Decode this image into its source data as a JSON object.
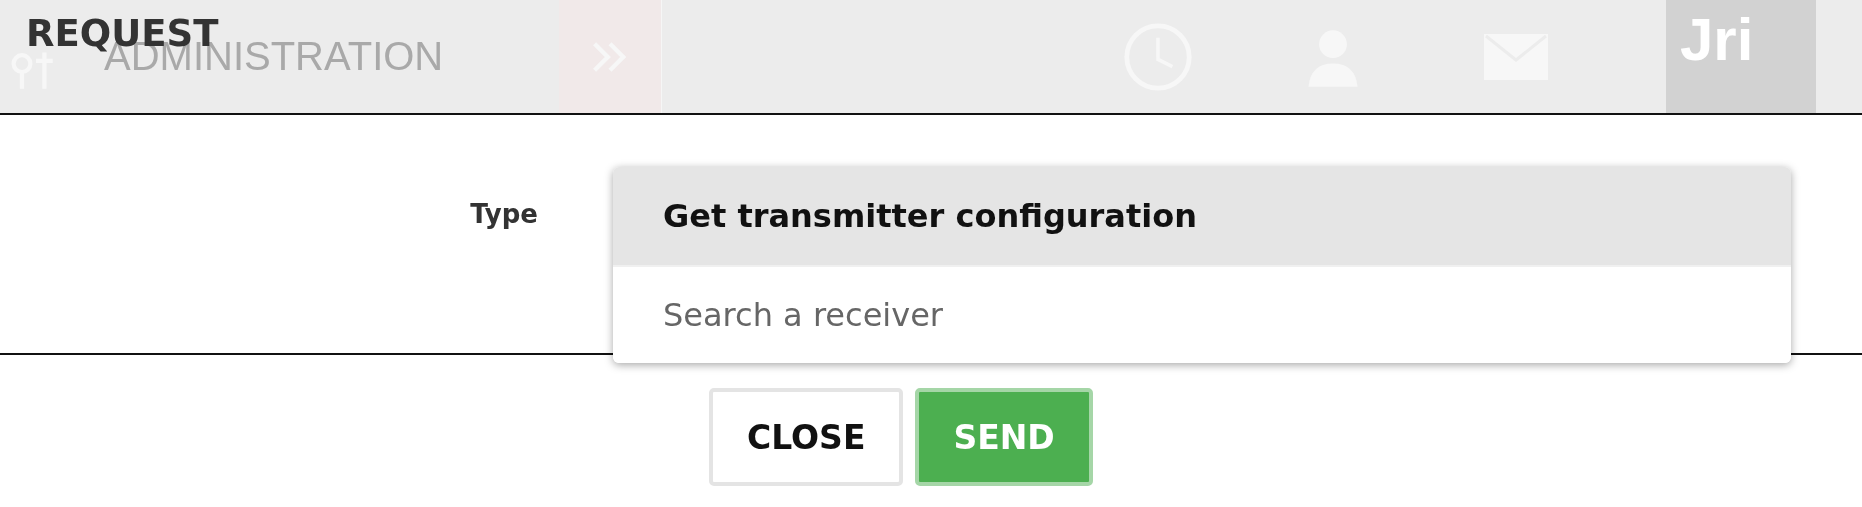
{
  "background_header": {
    "nav_label": "ADMINISTRATION",
    "logo": "Jri"
  },
  "dialog": {
    "title": "REQUEST",
    "field": {
      "label": "Type",
      "options": [
        {
          "label": "Get transmitter configuration",
          "selected": true
        }
      ],
      "search": {
        "placeholder": "Search a receiver"
      }
    },
    "buttons": [
      {
        "label": "CLOSE",
        "kind": "secondary"
      },
      {
        "label": "SEND",
        "kind": "primary"
      }
    ]
  }
}
